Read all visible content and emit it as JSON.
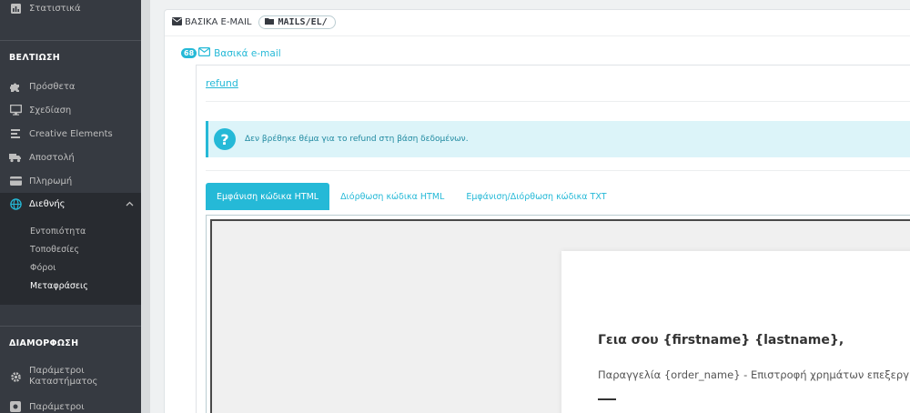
{
  "sidebar": {
    "top_item": {
      "label": "Στατιστικά",
      "icon": "bar-chart-icon"
    },
    "sections": [
      {
        "title": "ΒΕΛΤΙΩΣΗ"
      },
      {
        "title": "ΔΙΑΜΟΡΦΩΣΗ"
      }
    ],
    "items": [
      {
        "label": "Πρόσθετα",
        "icon": "puzzle-icon"
      },
      {
        "label": "Σχεδίαση",
        "icon": "monitor-icon"
      },
      {
        "label": "Creative Elements",
        "icon": "bars-icon"
      },
      {
        "label": "Αποστολή",
        "icon": "truck-icon"
      },
      {
        "label": "Πληρωμή",
        "icon": "credit-card-icon"
      },
      {
        "label": "Διεθνής",
        "icon": "globe-icon"
      }
    ],
    "sub_items": [
      "Εντοπιότητα",
      "Τοποθεσίες",
      "Φόροι",
      "Μεταφράσεις"
    ],
    "config_items": [
      {
        "label": "Παράμετροι Καταστήματος",
        "icon": "gear-icon"
      },
      {
        "label": "Παράμετροι",
        "icon": "cog-icon"
      }
    ]
  },
  "panel": {
    "header_title": "ΒΑΣΙΚΑ E-MAIL",
    "path": "MAILS/EL/",
    "mail_count": "68",
    "mail_title": "Βασικά e-mail",
    "refund_link": "refund",
    "alert_text": "Δεν βρέθηκε θέμα για το refund στη βάση δεδομένων.",
    "tabs": [
      "Εμφάνιση κώδικα HTML",
      "Διόρθωση κώδικα HTML",
      "Εμφάνιση/Διόρθωση κώδικα TXT"
    ],
    "preview": {
      "greeting": "Γεια σου {firstname} {lastname},",
      "order_line": "Παραγγελία {order_name} - Επιστροφή χρημάτων επεξεργ"
    }
  },
  "colors": {
    "sidebar_bg": "#363a41",
    "accent": "#25b9d7",
    "alert_bg": "#dcf4f9"
  }
}
